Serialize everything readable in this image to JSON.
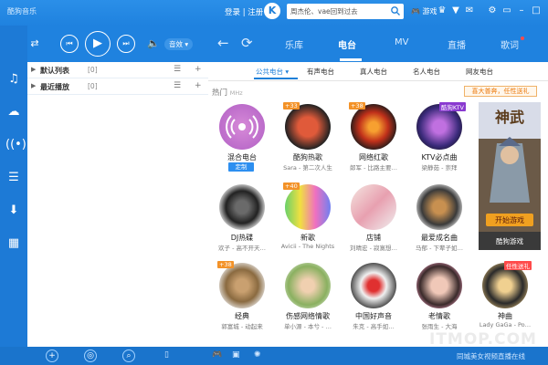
{
  "app": {
    "title": "酷狗音乐",
    "login": "登录 | 注册",
    "logo": "K",
    "search_placeholder": "周杰伦、vae回到过去",
    "game_label": "游戏"
  },
  "toolbar": {
    "sound_effect_label": "音效 ▾"
  },
  "playlist": {
    "items": [
      {
        "name": "默认列表",
        "count": "[0]"
      },
      {
        "name": "最近播放",
        "count": "[0]"
      }
    ]
  },
  "nav": {
    "tabs": [
      {
        "label": "乐库"
      },
      {
        "label": "电台"
      },
      {
        "label": "MV"
      },
      {
        "label": "直播"
      },
      {
        "label": "歌词"
      }
    ]
  },
  "subtabs": [
    "公共电台 ▾",
    "有声电台",
    "真人电台",
    "名人电台",
    "网友电台"
  ],
  "hot": {
    "label": "热门",
    "sublabel": "MHz",
    "badge": "喜大普奔，任性送礼"
  },
  "cards": [
    {
      "title": "混合电台",
      "sub": "定制",
      "corner": ""
    },
    {
      "title": "酷狗热歌",
      "sub": "Sara - 第二次人生",
      "corner": "+33"
    },
    {
      "title": "网络红歌",
      "sub": "郎军 - 比路主要…",
      "corner": "+38"
    },
    {
      "title": "KTV必点曲",
      "sub": "梁静茹 - 崇拜",
      "corner": "酷狗KTV"
    },
    {
      "title": "DJ热碟",
      "sub": "欢子 - 高不开天…",
      "corner": ""
    },
    {
      "title": "新歌",
      "sub": "Avicii - The Nights",
      "corner": "+40"
    },
    {
      "title": "店铺",
      "sub": "刘晴宏 - 寂寞想…",
      "corner": ""
    },
    {
      "title": "最爱成名曲",
      "sub": "马郁 - 下辈子如…",
      "corner": ""
    },
    {
      "title": "经典",
      "sub": "郭富城 - 动起来",
      "corner": "+38"
    },
    {
      "title": "伤感网络情歌",
      "sub": "单小源 - 本兮 - …",
      "corner": ""
    },
    {
      "title": "中国好声音",
      "sub": "朱克 - 高手如…",
      "corner": ""
    },
    {
      "title": "老情歌",
      "sub": "张雨生 - 大海",
      "corner": ""
    },
    {
      "title": "神曲",
      "sub": "Lady GaGa - Po…",
      "corner": "任性送礼"
    }
  ],
  "ad": {
    "brand": "神武",
    "button": "开始游戏",
    "footer": "酷狗游戏"
  },
  "bottom": {
    "text": "同城美女视频直播在线"
  },
  "watermark": "ITMOP.COM"
}
